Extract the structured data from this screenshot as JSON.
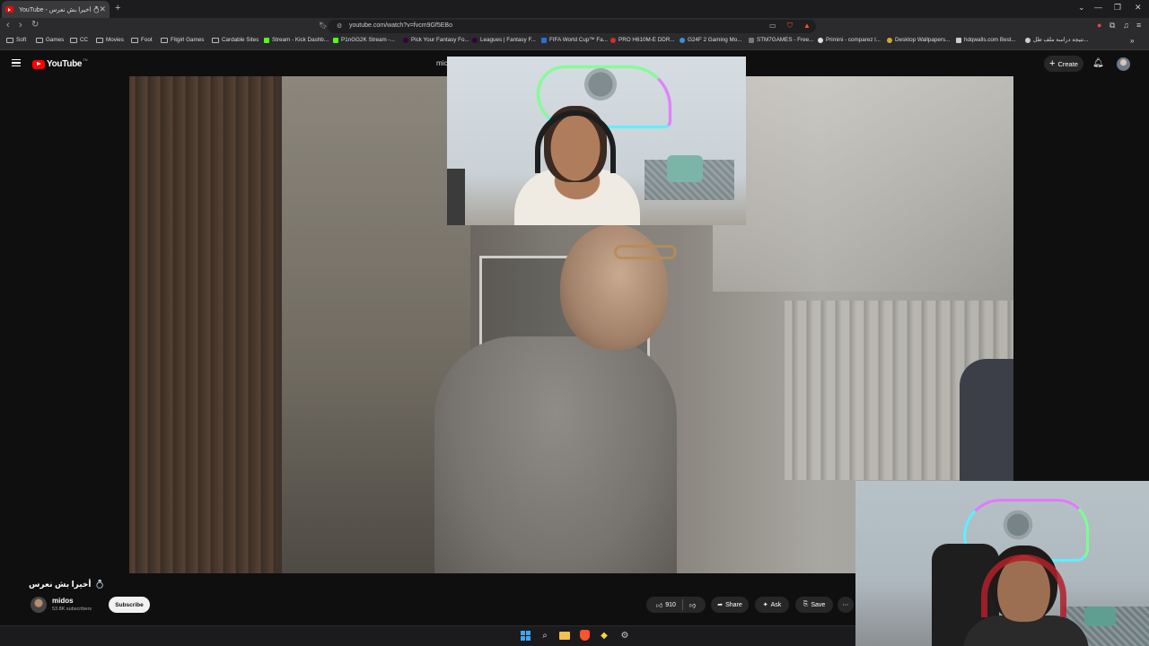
{
  "browser": {
    "tab_title": "YouTube - أخيرا بش نعرس 💍",
    "new_tab": "+",
    "url": "youtube.com/watch?v=fvcm9Gf5EBo",
    "window_controls": [
      "⌄",
      "—",
      "❐",
      "✕"
    ]
  },
  "bookmarks": [
    {
      "label": "Soft",
      "icon": "folder-icon"
    },
    {
      "label": "Games",
      "icon": "folder-icon"
    },
    {
      "label": "CC",
      "icon": "folder-icon"
    },
    {
      "label": "Movies",
      "icon": "folder-icon"
    },
    {
      "label": "Foot",
      "icon": "folder-icon"
    },
    {
      "label": "Fitgirl Games",
      "icon": "folder-icon"
    },
    {
      "label": "Cardable Sites",
      "icon": "folder-icon"
    },
    {
      "label": "Stream - Kick Dashb...",
      "icon": "kick-icon"
    },
    {
      "label": "P1nGG2K Stream -...",
      "icon": "kick-icon"
    },
    {
      "label": "Pick Your Fantasy Fo...",
      "icon": "site-icon"
    },
    {
      "label": "Leagues | Fantasy F...",
      "icon": "site-icon"
    },
    {
      "label": "FIFA World Cup™ Fa...",
      "icon": "fifa-icon"
    },
    {
      "label": "PRO H610M-E DDR...",
      "icon": "asus-icon"
    },
    {
      "label": "G24F 2 Gaming Mo...",
      "icon": "site-icon"
    },
    {
      "label": "STM7GAMES - Free...",
      "icon": "site-icon"
    },
    {
      "label": "Primini - comparez l...",
      "icon": "site-icon"
    },
    {
      "label": "Desktop Wallpapers...",
      "icon": "site-icon"
    },
    {
      "label": "hdqwalls.com Best...",
      "icon": "site-icon"
    },
    {
      "label": "نتيجة دراسة ملف طل...",
      "icon": "site-icon"
    }
  ],
  "youtube": {
    "logo_text": "YouTube",
    "logo_country": "TN",
    "search_peek": "mic",
    "create_label": "Create"
  },
  "video": {
    "title": "أخيرا بش نعرس",
    "title_emoji": "💍",
    "channel_name": "midos",
    "subscribers": "53.8K subscribers",
    "subscribe_label": "Subscribe",
    "likes": "910",
    "share_label": "Share",
    "ask_label": "Ask",
    "save_label": "Save"
  },
  "colors": {
    "yt_red": "#ff0000",
    "background": "#0f0f0f",
    "pill": "#272727"
  }
}
